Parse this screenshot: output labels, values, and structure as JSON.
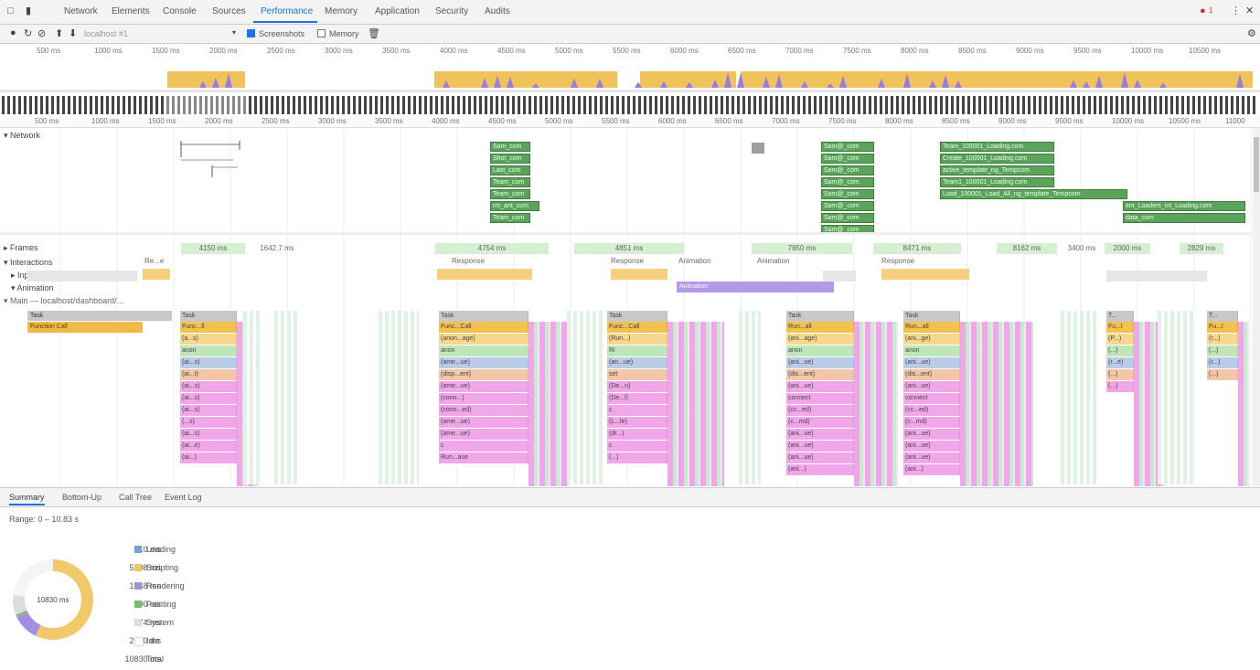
{
  "tabs": [
    "Network",
    "Elements",
    "Console",
    "Sources",
    "Performance",
    "Memory",
    "Application",
    "Security",
    "Audits"
  ],
  "active_tab": "Performance",
  "toolbar": {
    "url": "localhost #1",
    "screenshots_label": "Screenshots",
    "memory_label": "Memory"
  },
  "error_count": "1",
  "overview_ticks": [
    "500 ms",
    "1000 ms",
    "1500 ms",
    "2000 ms",
    "2500 ms",
    "3000 ms",
    "3500 ms",
    "4000 ms",
    "4500 ms",
    "5000 ms",
    "5500 ms",
    "6000 ms",
    "6500 ms",
    "7000 ms",
    "7500 ms",
    "8000 ms",
    "8500 ms",
    "9000 ms",
    "9500 ms",
    "10000 ms",
    "10500 ms"
  ],
  "ruler_ticks": [
    "500 ms",
    "1000 ms",
    "1500 ms",
    "2000 ms",
    "2500 ms",
    "3000 ms",
    "3500 ms",
    "4000 ms",
    "4500 ms",
    "5000 ms",
    "5500 ms",
    "6000 ms",
    "6500 ms",
    "7000 ms",
    "7500 ms",
    "8000 ms",
    "8500 ms",
    "9000 ms",
    "9500 ms",
    "10000 ms",
    "10500 ms",
    "11000"
  ],
  "tracks": {
    "network": "Network",
    "frames": "Frames",
    "interactions": "Interactions",
    "input": "Input",
    "animation": "Animation",
    "main": "Main — localhost/dashboard/..."
  },
  "network_items": [
    {
      "label": "Sam_com",
      "col": 0,
      "row": 0
    },
    {
      "label": "Shot_com",
      "col": 0,
      "row": 1
    },
    {
      "label": "Last_com",
      "col": 0,
      "row": 2
    },
    {
      "label": "Team_com",
      "col": 0,
      "row": 3
    },
    {
      "label": "Team_com",
      "col": 0,
      "row": 4
    },
    {
      "label": "rm_ant_com",
      "col": 0,
      "row": 5
    },
    {
      "label": "Team_com",
      "col": 0,
      "row": 6
    },
    {
      "label": "Sam@_com",
      "col": 1,
      "row": 0
    },
    {
      "label": "Sam@_com",
      "col": 1,
      "row": 1
    },
    {
      "label": "Sam@_com",
      "col": 1,
      "row": 2
    },
    {
      "label": "Sam@_com",
      "col": 1,
      "row": 3
    },
    {
      "label": "Sam@_com",
      "col": 1,
      "row": 4
    },
    {
      "label": "Sam@_com",
      "col": 1,
      "row": 5
    },
    {
      "label": "Sam@_com",
      "col": 1,
      "row": 6
    },
    {
      "label": "Sam@_com",
      "col": 1,
      "row": 7
    },
    {
      "label": "Team_100001_Loading.com",
      "col": 2,
      "row": 0
    },
    {
      "label": "Create_100001_Loading.com",
      "col": 2,
      "row": 1
    },
    {
      "label": "active_template_ng_Tempcom",
      "col": 2,
      "row": 2
    },
    {
      "label": "Team1_100001_Loading.com",
      "col": 2,
      "row": 3
    },
    {
      "label": "Load_100001_Load_All_ng_template_Tempcom",
      "col": 2,
      "row": 4
    },
    {
      "label": "ent_Loaders_int_Loading.com",
      "col": 3,
      "row": 5
    },
    {
      "label": "data_com",
      "col": 3,
      "row": 6
    }
  ],
  "frames": [
    {
      "label": "4150 ms",
      "w": 70
    },
    {
      "label": "1642.7 ms",
      "w": 8
    },
    {
      "label": "4754 ms",
      "w": 124
    },
    {
      "label": "4851 ms",
      "w": 120
    },
    {
      "label": "7850 ms",
      "w": 110
    },
    {
      "label": "8471 ms",
      "w": 96
    },
    {
      "label": "8162 ms",
      "w": 66
    },
    {
      "label": "3400 ms",
      "w": 42
    },
    {
      "label": "2000 ms",
      "w": 50
    },
    {
      "label": "2829 ms",
      "w": 48
    }
  ],
  "interactions": [
    {
      "label": "Re...e",
      "kind": "response"
    },
    {
      "label": "Response",
      "kind": "response"
    },
    {
      "label": "Response",
      "kind": "response"
    },
    {
      "label": "Animation",
      "kind": "animation"
    },
    {
      "label": "Animation",
      "kind": "animation"
    },
    {
      "label": "Response",
      "kind": "response"
    }
  ],
  "animation_block": "Animation",
  "main_first_task": "Task",
  "main_first_call": "Function Call",
  "flame_tasks": [
    {
      "task": "Task",
      "calls": [
        "Func...ll",
        "(a...s)",
        "anon",
        "(ai...s)",
        "(ai...t)",
        "(ai...s)",
        "(ai...s)",
        "(ai...s)",
        "(...s)",
        "(ai...s)",
        "(ai...e)",
        "(ai...)"
      ]
    },
    {
      "task": "Task",
      "calls": [
        "Func...Call",
        "(anon...age)",
        "anon",
        "(ame...ue)",
        "(disp...ent)",
        "(ame...ue)",
        "(conn...)",
        "(conn...ed)",
        "(ame...ue)",
        "(ame...ue)",
        "c",
        "Run...ase"
      ]
    },
    {
      "task": "Task",
      "calls": [
        "Func...Call",
        "(Run...)",
        "Ri",
        "(an...ue)",
        "set",
        "(De...n)",
        "(De...l)",
        "c",
        "(L...le)",
        "(dr...)",
        "c",
        "(...)"
      ]
    },
    {
      "task": "Task",
      "calls": [
        "Run...all",
        "(ani...age)",
        "anon",
        "(ani...ue)",
        "(dis...ent)",
        "(ani...ue)",
        "connect",
        "(cc...ed)",
        "(c...md)",
        "(ani...ue)",
        "(ani...ue)",
        "(ani...ue)",
        "(ani...)"
      ]
    },
    {
      "task": "Task",
      "calls": [
        "Run...all",
        "(ani...ge)",
        "anon",
        "(ani...ue)",
        "(dis...ent)",
        "(ani...ue)",
        "connect",
        "(cc...ed)",
        "(c...md)",
        "(ani...ue)",
        "(ani...ue)",
        "(ani...ue)",
        "(ani...)"
      ]
    },
    {
      "task": "T...",
      "calls": [
        "Fu...l",
        "(P...)",
        "(...)",
        "(r...e)",
        "(...)",
        "(...)"
      ]
    },
    {
      "task": "T...",
      "calls": [
        "Fu...l",
        "(r...)",
        "(...)",
        "(r...)",
        "(...)"
      ]
    }
  ],
  "bottom_tabs": [
    "Summary",
    "Bottom-Up",
    "Call Tree",
    "Event Log"
  ],
  "active_bottom_tab": "Summary",
  "range": "Range: 0 – 10.83 s",
  "summary": {
    "total_label": "10830 ms",
    "items": [
      {
        "value": "10 ms",
        "name": "Loading",
        "color": "#6ea4d9",
        "ms": 10
      },
      {
        "value": "5608 ms",
        "name": "Scripting",
        "color": "#f2c96a",
        "ms": 5608
      },
      {
        "value": "1048 ms",
        "name": "Rendering",
        "color": "#a38ee0",
        "ms": 1048
      },
      {
        "value": "100 ms",
        "name": "Painting",
        "color": "#7dbb74",
        "ms": 100
      },
      {
        "value": "774 ms",
        "name": "System",
        "color": "#dcdcdc",
        "ms": 774
      },
      {
        "value": "2290 ms",
        "name": "Idle",
        "color": "#ffffff",
        "ms": 2290
      },
      {
        "value": "10830 ms",
        "name": "Total",
        "color": "",
        "ms": 0
      }
    ]
  }
}
